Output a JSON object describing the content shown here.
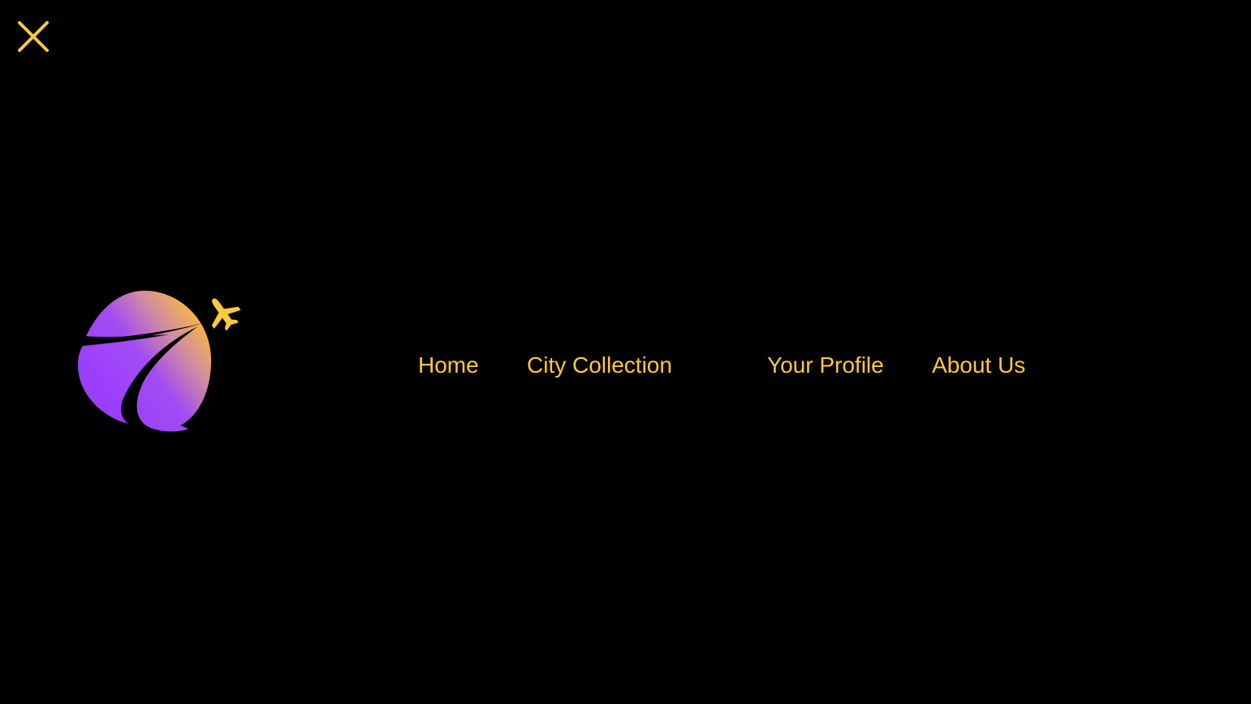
{
  "colors": {
    "background": "#000000",
    "accent": "#FFC83D",
    "logo_purple": "#9B4DFF",
    "logo_orange": "#F0B050"
  },
  "icons": {
    "close": "close-icon",
    "logo": "globe-airplane-logo",
    "airplane": "airplane-icon"
  },
  "nav": {
    "items": [
      {
        "label": "Home"
      },
      {
        "label": "City Collection"
      },
      {
        "label": "Your Profile"
      },
      {
        "label": "About Us"
      }
    ]
  }
}
